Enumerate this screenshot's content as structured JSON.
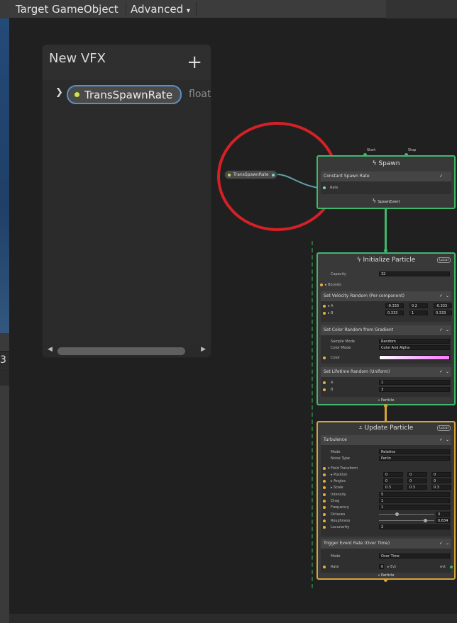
{
  "toolbar": {
    "target_gameobject": "Target GameObject",
    "advanced": "Advanced",
    "advanced_icon": "dropdown-arrow-icon"
  },
  "left_strip": {
    "row_label": "3"
  },
  "blackboard": {
    "title": "New VFX",
    "add_icon": "plus-icon",
    "property": {
      "name": "TransSpawnRate",
      "type": "float"
    }
  },
  "property_node": {
    "label": "TransSpawnRate"
  },
  "spawn": {
    "title": "Spawn",
    "start_label": "Start",
    "stop_label": "Stop",
    "block_title": "Constant Spawn Rate",
    "rate_label": "Rate",
    "output_label": "SpawnEvent"
  },
  "initialize": {
    "title": "Initialize Particle",
    "badge": "Local",
    "capacity_label": "Capacity",
    "capacity_value": "32",
    "bounds_label": "Bounds",
    "velocity_block": "Set Velocity Random (Per-component)",
    "a_label": "A",
    "b_label": "B",
    "a_values": [
      "-0.333",
      "0.2",
      "-0.333"
    ],
    "b_values": [
      "0.333",
      "1",
      "0.333"
    ],
    "color_block": "Set Color Random from Gradient",
    "sample_mode_label": "Sample Mode",
    "sample_mode_value": "Random",
    "color_mode_label": "Color Mode",
    "color_mode_value": "Color And Alpha",
    "color_label": "Color",
    "lifetime_block": "Set Lifetime Random (Uniform)",
    "lifetime_a": "1",
    "lifetime_b": "3",
    "output_label": "Particle"
  },
  "update": {
    "title": "Update Particle",
    "badge": "Local",
    "turbulence_block": "Turbulence",
    "mode_label": "Mode",
    "mode_value": "Relative",
    "noise_type_label": "Noise Type",
    "noise_type_value": "Perlin",
    "field_transform_label": "Field Transform",
    "position_label": "Position",
    "angles_label": "Angles",
    "scale_label": "Scale",
    "position_values": [
      "0",
      "0",
      "0"
    ],
    "angles_values": [
      "0",
      "0",
      "0"
    ],
    "scale_values": [
      "0.3",
      "0.3",
      "0.3"
    ],
    "intensity_label": "Intensity",
    "intensity_value": "5",
    "drag_label": "Drag",
    "drag_value": "1",
    "frequency_label": "Frequency",
    "frequency_value": "1",
    "octaves_label": "Octaves",
    "octaves_value": "3",
    "roughness_label": "Roughness",
    "roughness_value": "0.834",
    "lacunarity_label": "Lacunarity",
    "lacunarity_value": "2",
    "trigger_block": "Trigger Event Rate (Over Time)",
    "trigger_mode_label": "Mode",
    "trigger_mode_value": "Over Time",
    "trigger_rate_label": "Rate",
    "trigger_rate_field": "0",
    "evt_label": "Evt",
    "evt_out": "evt",
    "output_label": "Particle"
  }
}
